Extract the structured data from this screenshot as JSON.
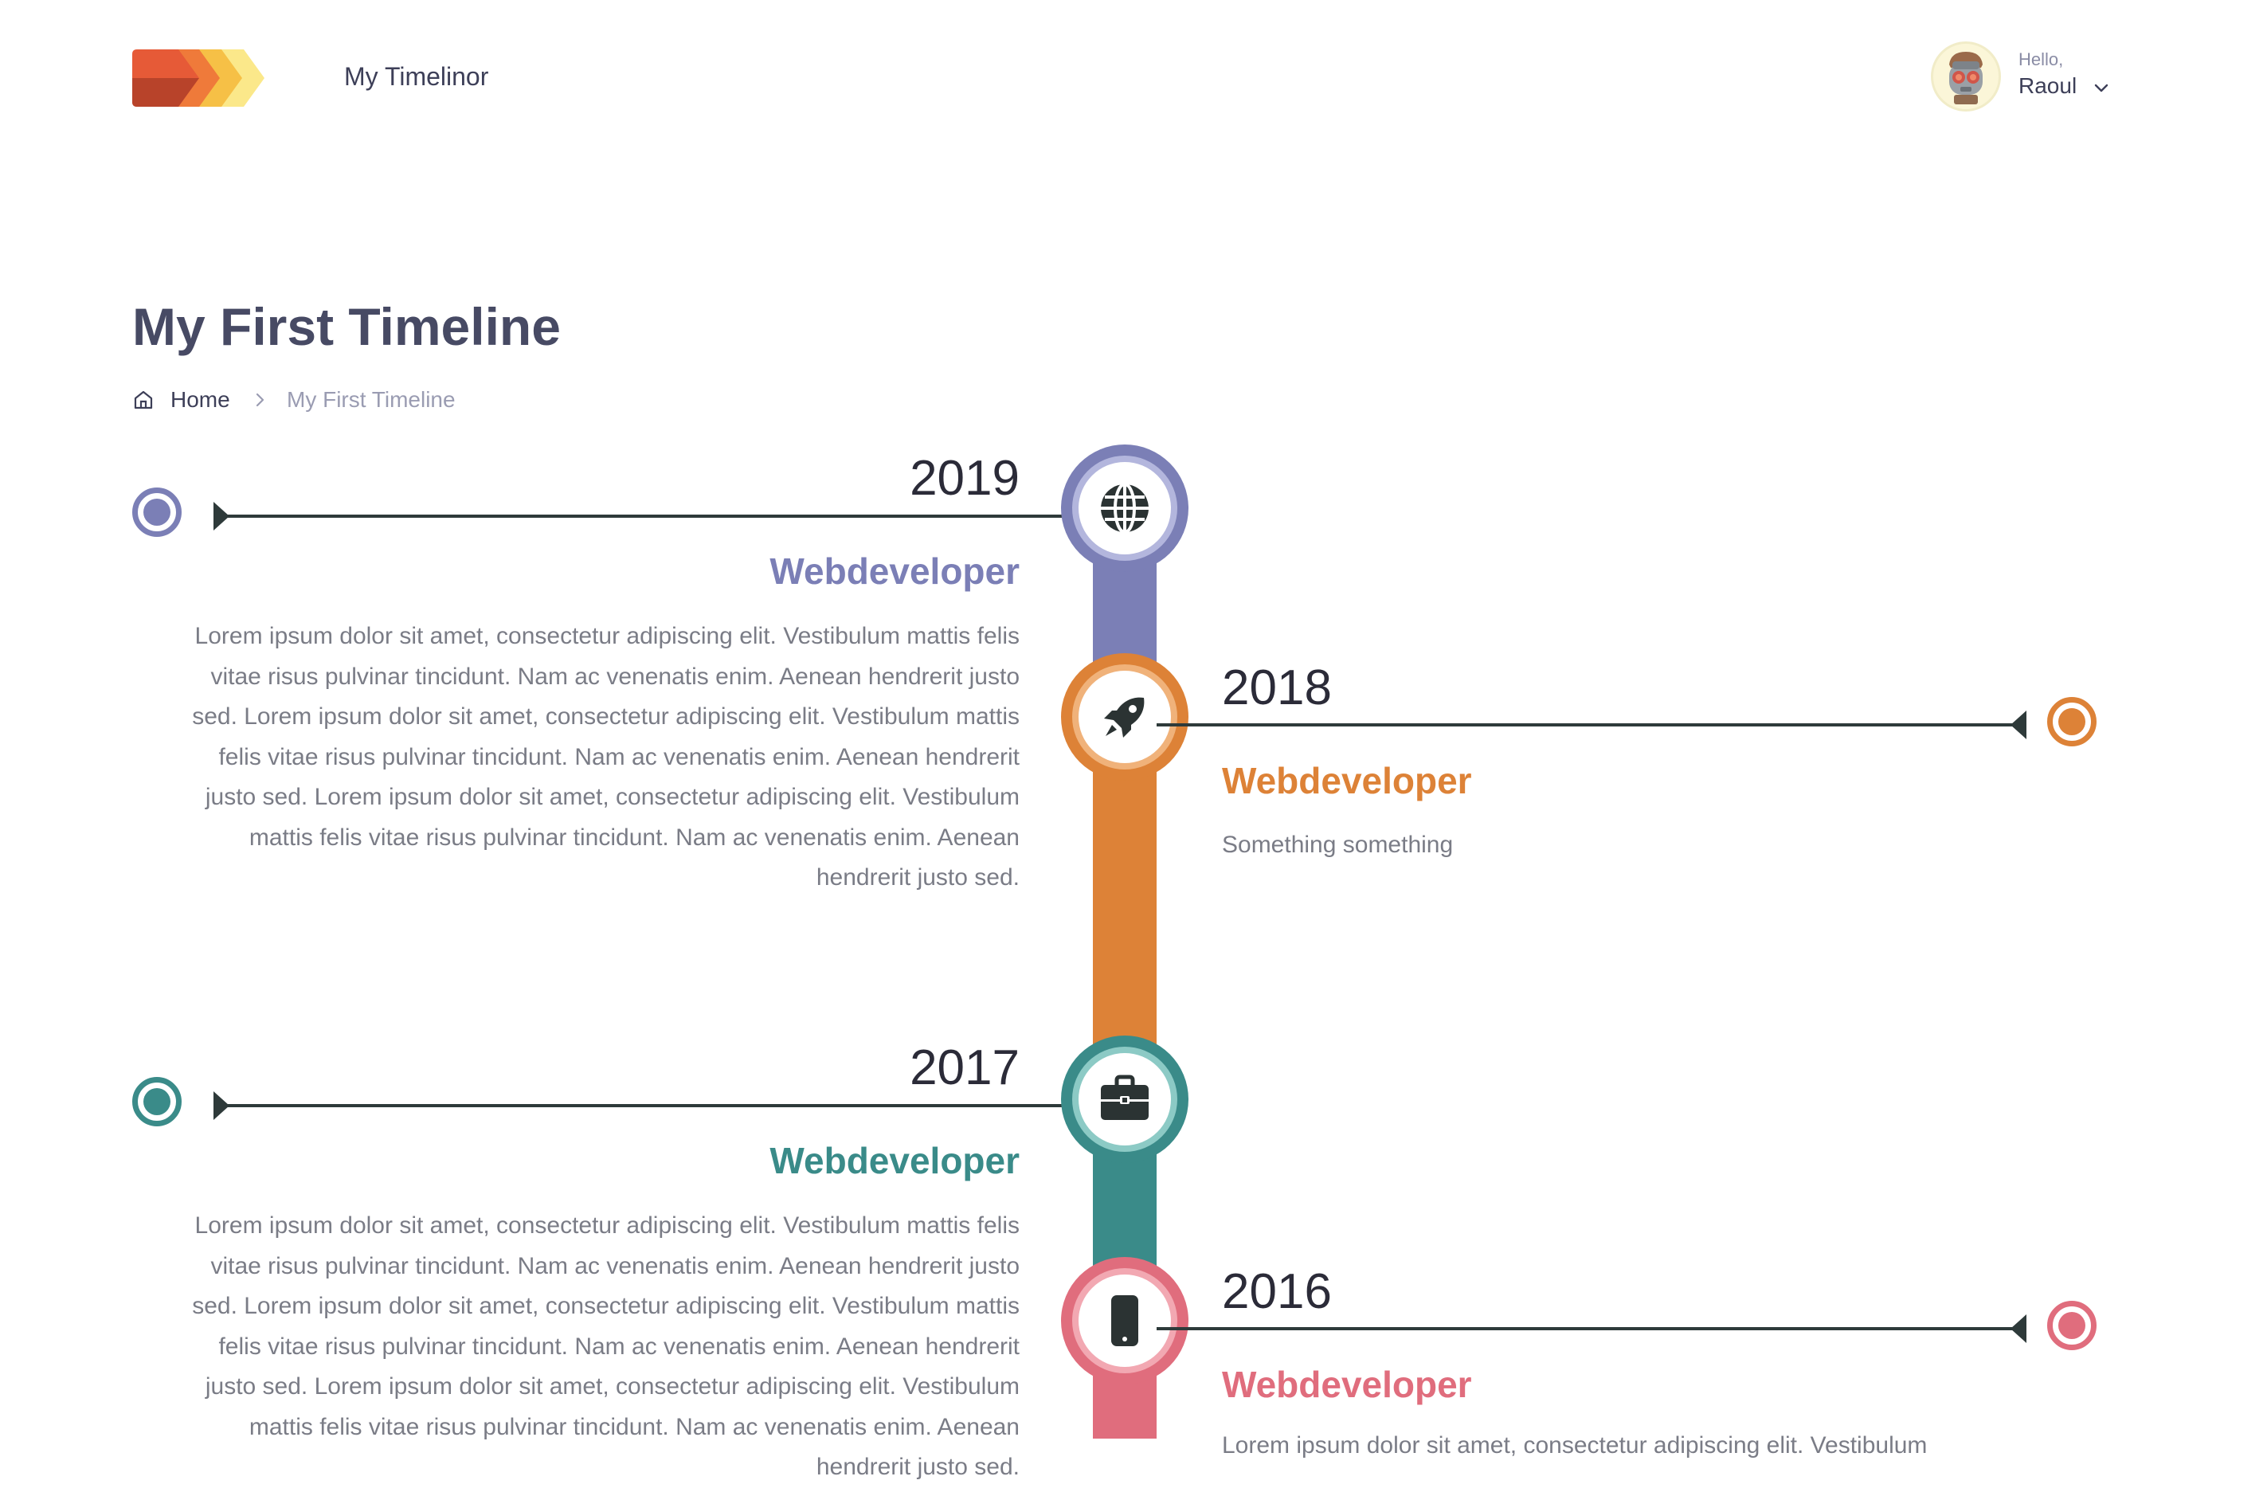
{
  "header": {
    "app_title": "My Timelinor",
    "logo": "chevron-stack-logo",
    "greeting": "Hello,",
    "user_name": "Raoul"
  },
  "page": {
    "title": "My First Timeline"
  },
  "breadcrumb": {
    "home": "Home",
    "current": "My First Timeline"
  },
  "colors": {
    "purple": "#7b7fb6",
    "orange": "#dd8237",
    "teal": "#3a8b89",
    "pink": "#e06d7d",
    "line": "#2e3a3a"
  },
  "timeline": [
    {
      "year": "2019",
      "role": "Webdeveloper",
      "icon": "globe-icon",
      "side": "left",
      "description": "Lorem ipsum dolor sit amet, consectetur adipiscing elit. Vestibulum mattis felis vitae risus pulvinar tincidunt. Nam ac venenatis enim. Aenean hendrerit justo sed. Lorem ipsum dolor sit amet, consectetur adipiscing elit. Vestibulum mattis felis vitae risus pulvinar tincidunt. Nam ac venenatis enim. Aenean hendrerit justo sed. Lorem ipsum dolor sit amet, consectetur adipiscing elit. Vestibulum mattis felis vitae risus pulvinar tincidunt. Nam ac venenatis enim. Aenean hendrerit justo sed."
    },
    {
      "year": "2018",
      "role": "Webdeveloper",
      "icon": "rocket-icon",
      "side": "right",
      "description": "Something something"
    },
    {
      "year": "2017",
      "role": "Webdeveloper",
      "icon": "briefcase-icon",
      "side": "left",
      "description": "Lorem ipsum dolor sit amet, consectetur adipiscing elit. Vestibulum mattis felis vitae risus pulvinar tincidunt. Nam ac venenatis enim. Aenean hendrerit justo sed. Lorem ipsum dolor sit amet, consectetur adipiscing elit. Vestibulum mattis felis vitae risus pulvinar tincidunt. Nam ac venenatis enim. Aenean hendrerit justo sed. Lorem ipsum dolor sit amet, consectetur adipiscing elit. Vestibulum mattis felis vitae risus pulvinar tincidunt. Nam ac venenatis enim. Aenean hendrerit justo sed."
    },
    {
      "year": "2016",
      "role": "Webdeveloper",
      "icon": "smartphone-icon",
      "side": "right",
      "description": "Lorem ipsum dolor sit amet, consectetur adipiscing elit. Vestibulum"
    }
  ]
}
